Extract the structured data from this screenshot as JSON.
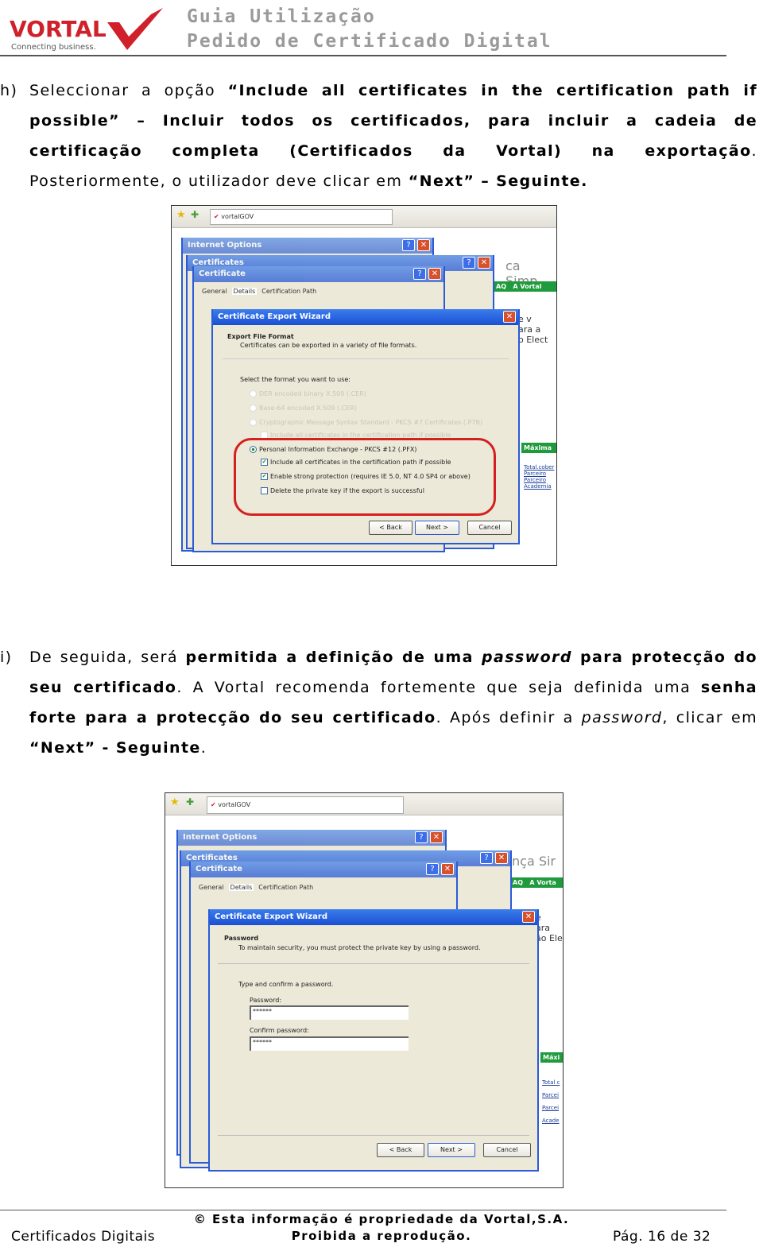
{
  "header": {
    "logo_text": "VORTAL",
    "logo_tagline": "Connecting business.",
    "title_line1": "Guia Utilização",
    "title_line2": "Pedido de Certificado Digital"
  },
  "section_h": {
    "label": "h)",
    "segments": [
      {
        "t": "Seleccionar a opção ",
        "s": ""
      },
      {
        "t": "“Include all certificates in the certification path if possible” – Incluir todos os certificados, para incluir a cadeia de certificação completa (Certificados da Vortal) na exportação",
        "s": "b"
      },
      {
        "t": ". Posteriormente, o utilizador deve clicar em ",
        "s": ""
      },
      {
        "t": "“Next” – Seguinte.",
        "s": "b"
      }
    ]
  },
  "screenshot_h": {
    "browser_tab": "vortalGOV",
    "windows": [
      "Internet Options",
      "Certificates",
      "Certificate"
    ],
    "tabs": [
      "General",
      "Details",
      "Certification Path"
    ],
    "wizard": {
      "title": "Certificate Export Wizard",
      "heading": "Export File Format",
      "subheading": "Certificates can be exported in a variety of file formats.",
      "prompt": "Select the format you want to use:",
      "options": [
        {
          "label": "DER encoded binary X.509 (.CER)",
          "enabled": false
        },
        {
          "label": "Base-64 encoded X.509 (.CER)",
          "enabled": false
        },
        {
          "label": "Cryptographic Message Syntax Standard - PKCS #7 Certificates (.P7B)",
          "enabled": false
        },
        {
          "label": "Include all certificates in the certification path if possible",
          "enabled": false
        },
        {
          "label": "Personal Information Exchange - PKCS #12 (.PFX)",
          "enabled": true,
          "selected": true
        },
        {
          "label": "Include all certificates in the certification path if possible",
          "checked": true
        },
        {
          "label": "Enable strong protection (requires IE 5.0, NT 4.0 SP4 or above)",
          "checked": true
        },
        {
          "label": "Delete the private key if the export is successful",
          "checked": false
        }
      ],
      "back": "< Back",
      "next": "Next >",
      "cancel": "Cancel"
    },
    "highlight_color": "#d42020"
  },
  "section_i": {
    "label": "i)",
    "segments": [
      {
        "t": "De seguida, será ",
        "s": ""
      },
      {
        "t": "permitida a definição de uma ",
        "s": "b"
      },
      {
        "t": "password",
        "s": "bi"
      },
      {
        "t": " para protecção do seu certificado",
        "s": "b"
      },
      {
        "t": ". A Vortal recomenda fortemente que seja definida uma ",
        "s": ""
      },
      {
        "t": "senha forte para a protecção do seu certificado",
        "s": "b"
      },
      {
        "t": ". Após definir a ",
        "s": ""
      },
      {
        "t": "password",
        "s": "i"
      },
      {
        "t": ", clicar em ",
        "s": ""
      },
      {
        "t": "“Next” - Seguinte",
        "s": "b"
      },
      {
        "t": ".",
        "s": ""
      }
    ]
  },
  "screenshot_i": {
    "browser_tab": "vortalGOV",
    "windows": [
      "Internet Options",
      "Certificates",
      "Certificate"
    ],
    "tabs": [
      "General",
      "Details",
      "Certification Path"
    ],
    "wizard": {
      "title": "Certificate Export Wizard",
      "heading": "Password",
      "subheading": "To maintain security, you must protect the private key by using a password.",
      "prompt": "Type and confirm a password.",
      "password_label": "Password:",
      "password_value": "******",
      "confirm_label": "Confirm password:",
      "confirm_value": "******",
      "back": "< Back",
      "next": "Next >",
      "cancel": "Cancel"
    }
  },
  "footer": {
    "left": "Certificados Digitais",
    "center_line1": "© Esta informação é propriedade da Vortal,S.A.",
    "center_line2": "Proibida a reprodução.",
    "right": "Pág. 16 de 32"
  },
  "colors": {
    "brand_red": "#d0202a",
    "header_grey": "#9a9a9a",
    "xp_blue": "#1b4fd3"
  }
}
